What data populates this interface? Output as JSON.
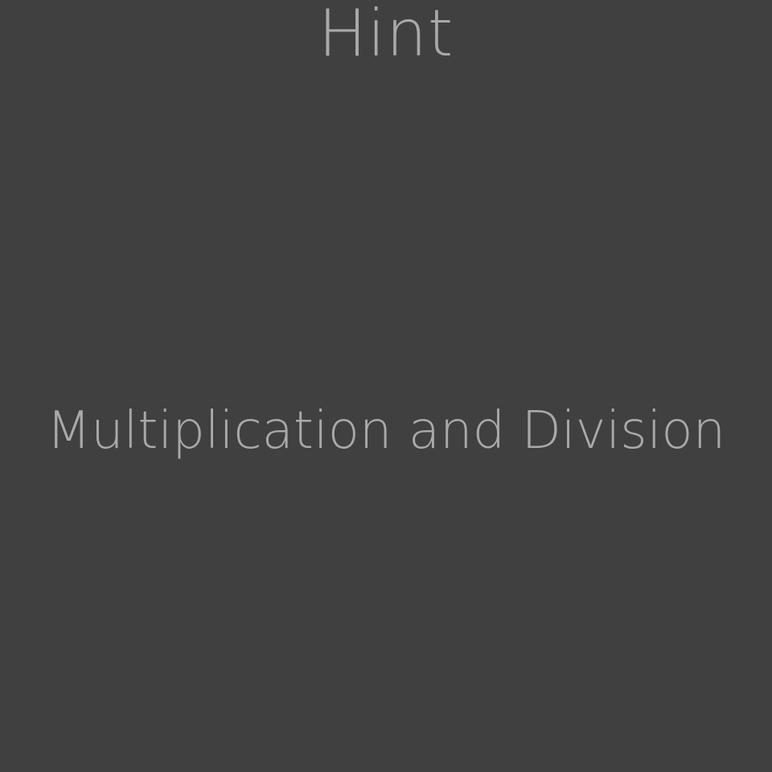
{
  "hint": {
    "title": "Hint",
    "text": "Multiplication and Division"
  },
  "colors": {
    "background": "#404040",
    "text": "#a9a9a9"
  }
}
